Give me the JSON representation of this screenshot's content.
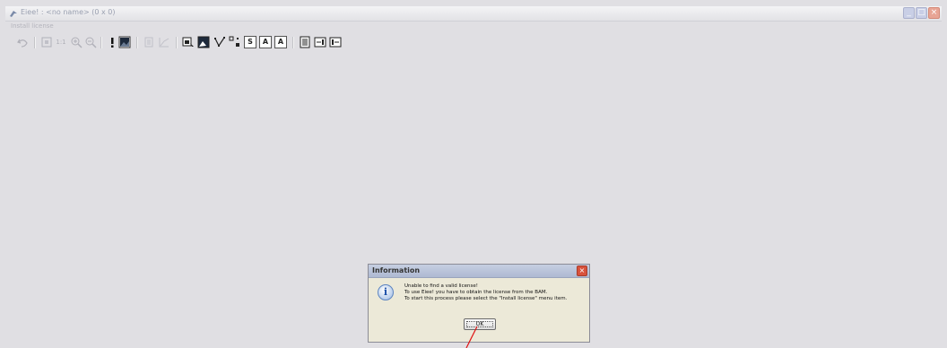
{
  "window": {
    "title": "Eiee! : <no name> (0 x 0)",
    "controls": [
      "minimize",
      "maximize",
      "close"
    ]
  },
  "menubar": {
    "items": [
      {
        "label": "Install license"
      }
    ]
  },
  "toolbar": {
    "zoom_actual_label": "1:1",
    "tools": [
      "undo-icon",
      "fit-icon",
      "zoom-actual-icon",
      "zoom-in-icon",
      "zoom-out-icon",
      "exclamation-icon",
      "image-icon",
      "list-icon",
      "chart-icon",
      "select-region-icon",
      "image-region-icon",
      "polyline-icon",
      "points-icon",
      "text-tool-icon",
      "text-box-icon",
      "text-box-alt-icon",
      "document-icon",
      "align-right-icon",
      "align-left-icon"
    ],
    "text_tool_label": "S",
    "text_box_label": "A",
    "text_box_alt_label": "A"
  },
  "dialog": {
    "title": "Information",
    "icon": "info-icon",
    "message_lines": [
      "Unable to find a valid license!",
      "To use Eiee! you have to obtain the license from the BAM.",
      "To start this process please select the \"Install license\" menu item."
    ],
    "ok_label": "OK"
  },
  "colors": {
    "background": "#e0dfe3",
    "dialog_title": "#aeb9d2",
    "close_button": "#d8523c",
    "annotation_arrow": "#e01010"
  }
}
